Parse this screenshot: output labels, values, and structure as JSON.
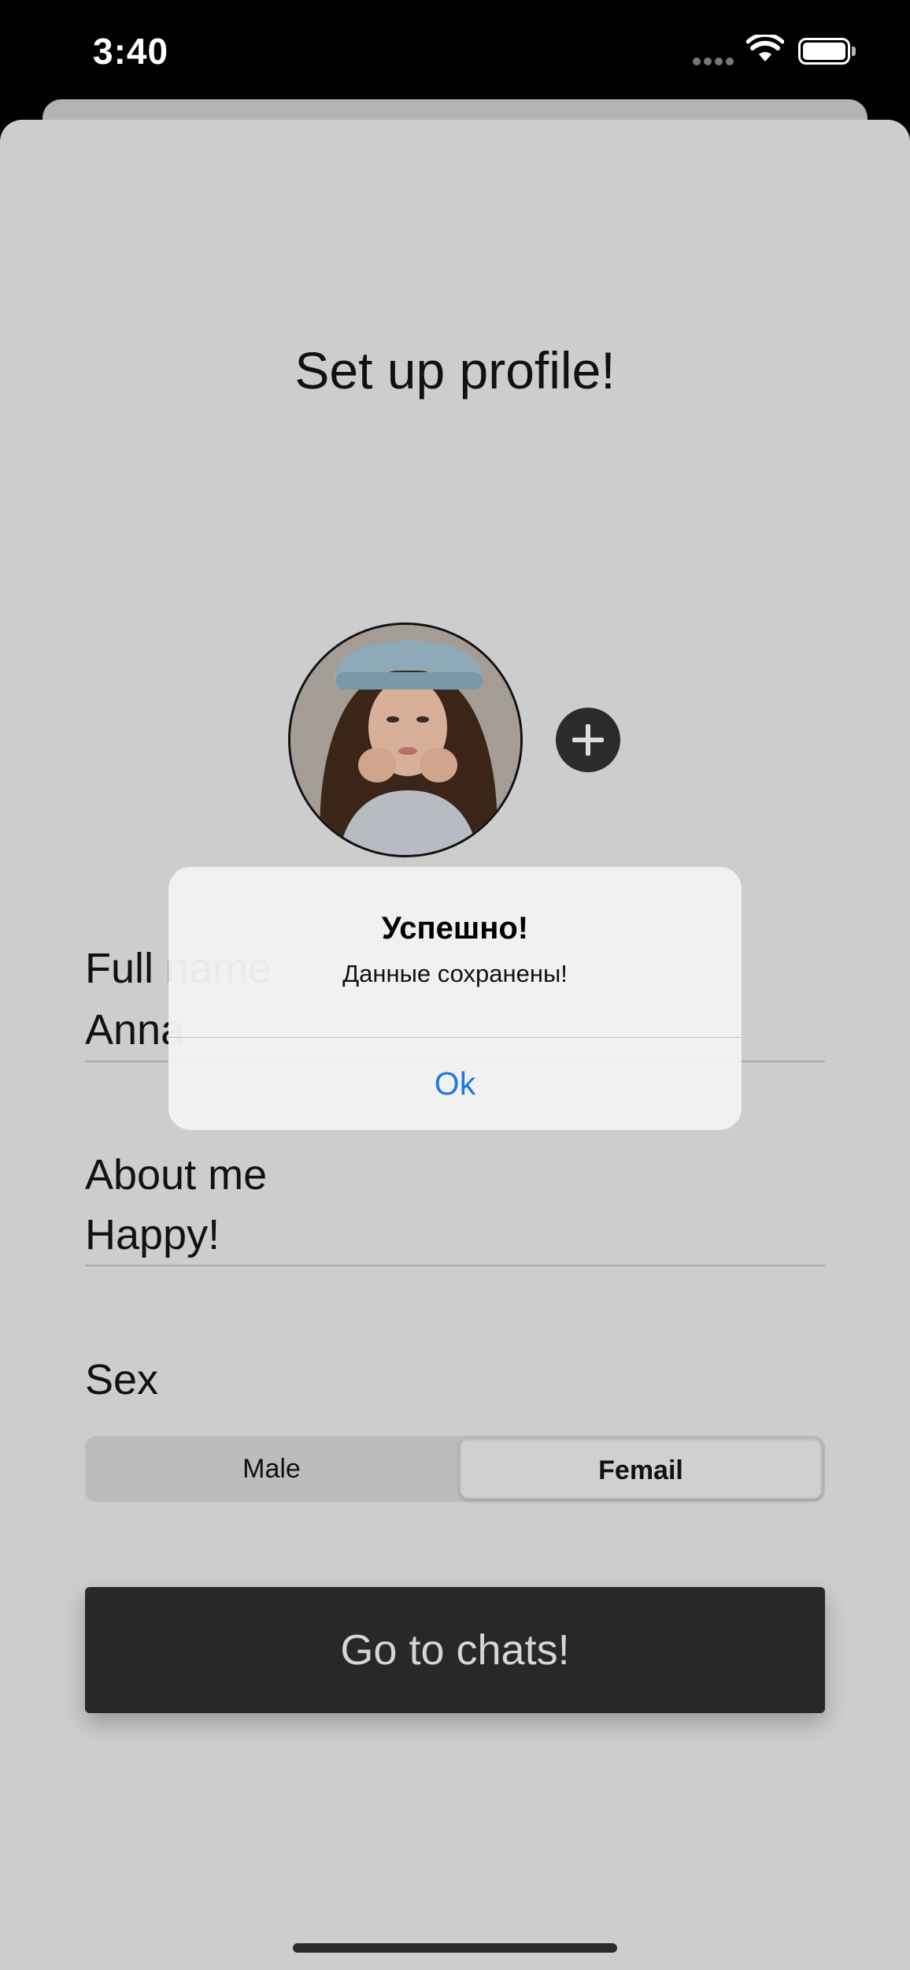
{
  "status_bar": {
    "time": "3:40",
    "icons": [
      "cellular-signal-icon",
      "wifi-icon",
      "battery-icon"
    ]
  },
  "profile": {
    "title": "Set up profile!",
    "avatar_icon": "user-photo",
    "add_photo_icon": "plus-icon"
  },
  "form": {
    "full_name": {
      "label": "Full name",
      "value": "Anna"
    },
    "about_me": {
      "label": "About me",
      "value": "Happy!"
    },
    "sex": {
      "label": "Sex",
      "options": [
        "Male",
        "Femail"
      ],
      "selected": "Femail"
    },
    "submit_label": "Go to chats!"
  },
  "alert": {
    "title": "Успешно!",
    "message": "Данные сохранены!",
    "ok_label": "Ok",
    "ok_color": "#1f7ae0"
  },
  "colors": {
    "sheet_background": "#cdcdcd",
    "dark_button": "#282828"
  }
}
